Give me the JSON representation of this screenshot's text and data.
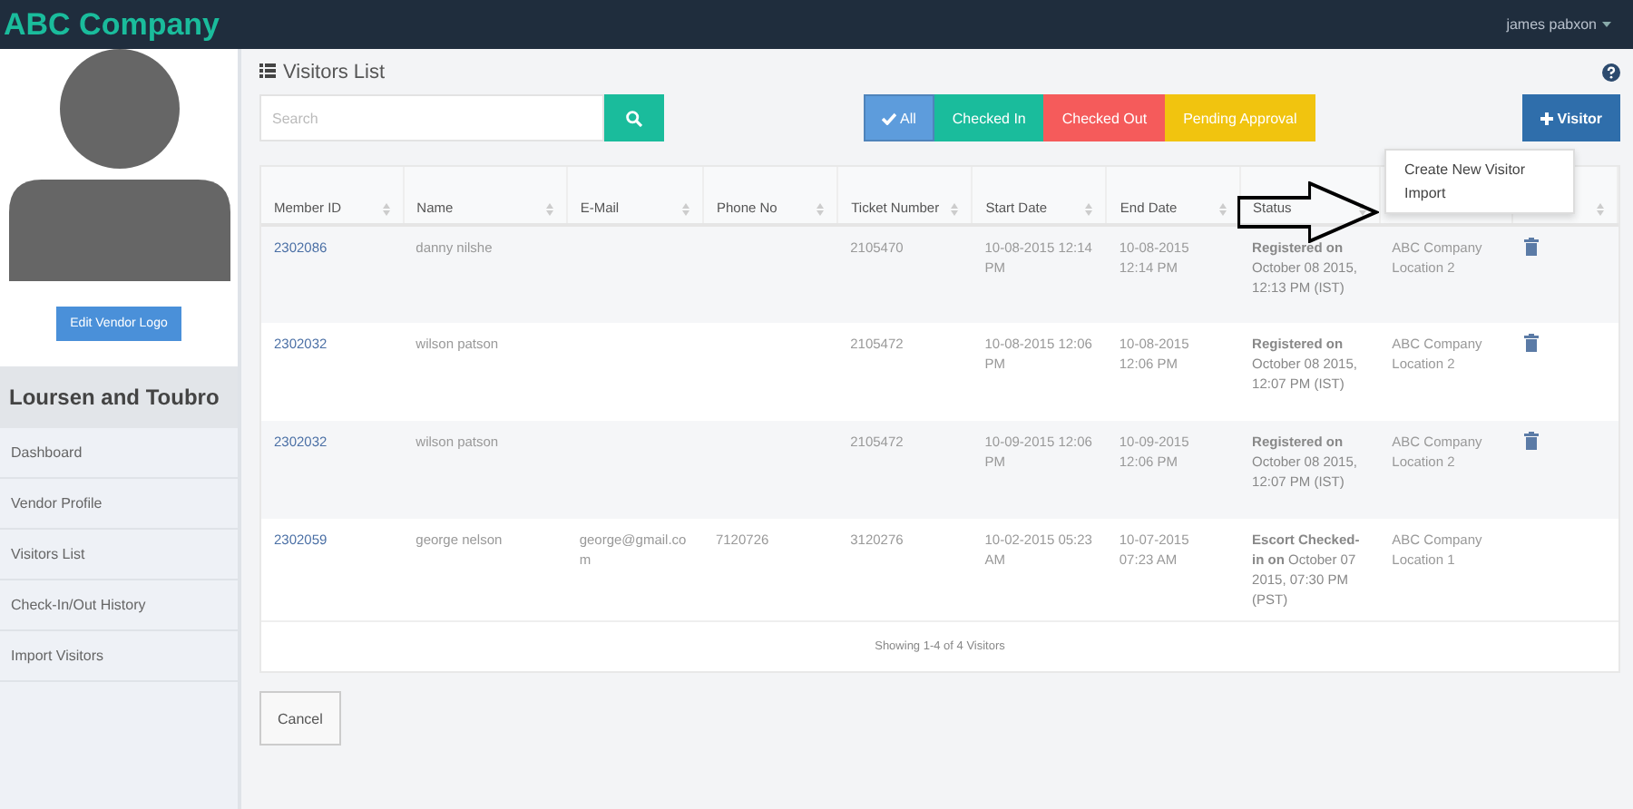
{
  "topbar": {
    "brand": "ABC Company",
    "user": "james pabxon"
  },
  "sidebar": {
    "edit_logo_button": "Edit Vendor Logo",
    "company": "Loursen and Toubro",
    "items": [
      {
        "label": "Dashboard"
      },
      {
        "label": "Vendor Profile"
      },
      {
        "label": "Visitors List"
      },
      {
        "label": "Check-In/Out History"
      },
      {
        "label": "Import Visitors"
      }
    ]
  },
  "page": {
    "title": "Visitors List"
  },
  "search": {
    "placeholder": "Search"
  },
  "filters": [
    {
      "label": "All",
      "selected": true,
      "color": "#5d9cdc"
    },
    {
      "label": "Checked In",
      "selected": false,
      "color": "#1abc9c"
    },
    {
      "label": "Checked Out",
      "selected": false,
      "color": "#f55b5b"
    },
    {
      "label": "Pending Approval",
      "selected": false,
      "color": "#f1c40f"
    }
  ],
  "add_button": "Visitor",
  "add_menu": {
    "open": true,
    "items": [
      "Create New Visitor",
      "Import"
    ]
  },
  "table": {
    "columns": [
      {
        "label": "Member ID"
      },
      {
        "label": "Name"
      },
      {
        "label": "E-Mail"
      },
      {
        "label": "Phone No"
      },
      {
        "label": "Ticket Number"
      },
      {
        "label": "Start Date"
      },
      {
        "label": "End Date"
      },
      {
        "label": "Status"
      }
    ],
    "rows": [
      {
        "member_id": "2302086",
        "name": "danny nilshe",
        "email": "",
        "phone": "",
        "ticket": "2105470",
        "start": "10-08-2015 12:14 PM",
        "end": "10-08-2015 12:14 PM",
        "status": "**Registered on** October 08 2015, 12:13 PM (IST)",
        "location": "ABC Company Location 2",
        "deletable": true
      },
      {
        "member_id": "2302032",
        "name": "wilson patson",
        "email": "",
        "phone": "",
        "ticket": "2105472",
        "start": "10-08-2015 12:06 PM",
        "end": "10-08-2015 12:06 PM",
        "status": "**Registered on** October 08 2015, 12:07 PM (IST)",
        "location": "ABC Company Location 2",
        "deletable": true
      },
      {
        "member_id": "2302032",
        "name": "wilson patson",
        "email": "",
        "phone": "",
        "ticket": "2105472",
        "start": "10-09-2015 12:06 PM",
        "end": "10-09-2015 12:06 PM",
        "status": "**Registered on** October 08 2015, 12:07 PM (IST)",
        "location": "ABC Company Location 2",
        "deletable": true
      },
      {
        "member_id": "2302059",
        "name": "george nelson",
        "email": "george@gmail.com",
        "phone": "7120726",
        "ticket": "3120276",
        "start": "10-02-2015 05:23 AM",
        "end": "10-07-2015 07:23 AM",
        "status": "**Escort Checked-in on** October 07 2015, 07:30 PM (PST)",
        "location": "ABC Company Location 1",
        "deletable": false
      }
    ],
    "footer": "Showing 1-4 of 4 Visitors"
  },
  "cancel_button": "Cancel"
}
